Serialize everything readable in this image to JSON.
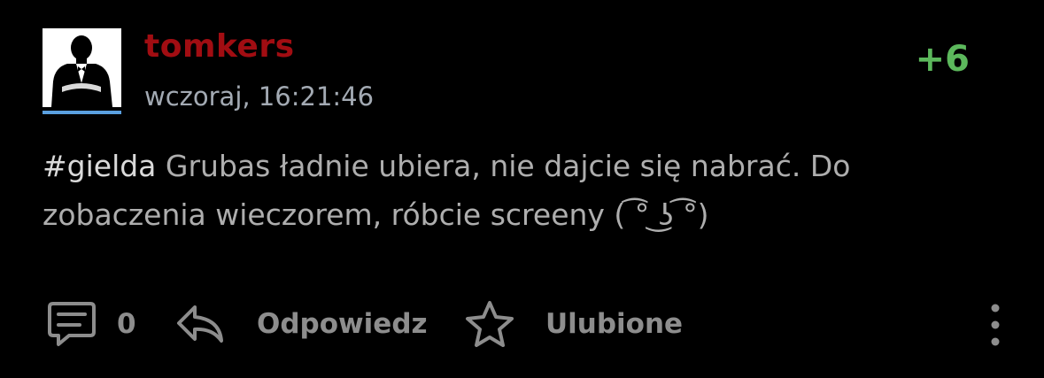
{
  "entry": {
    "author": "tomkers",
    "time": "wczoraj, 16:21:46",
    "score": "+6",
    "tag": "#gielda",
    "text": " Grubas ładnie ubiera, nie dajcie się nabrać. Do zobaczenia wieczorem, róbcie screeny ( ͡° ͜ʖ ͡°)"
  },
  "actions": {
    "comments_count": "0",
    "reply_label": "Odpowiedz",
    "favorite_label": "Ulubione"
  },
  "icons": {
    "comment": "comment-icon",
    "reply": "reply-icon",
    "favorite": "star-icon",
    "more": "more-vertical-icon"
  },
  "colors": {
    "background": "#000000",
    "author": "#a10d12",
    "score": "#5cb85c",
    "avatar_bar": "#5aa0e0",
    "meta": "#a3aab3",
    "text": "#aeaeae",
    "actions": "#8d8d8d"
  }
}
